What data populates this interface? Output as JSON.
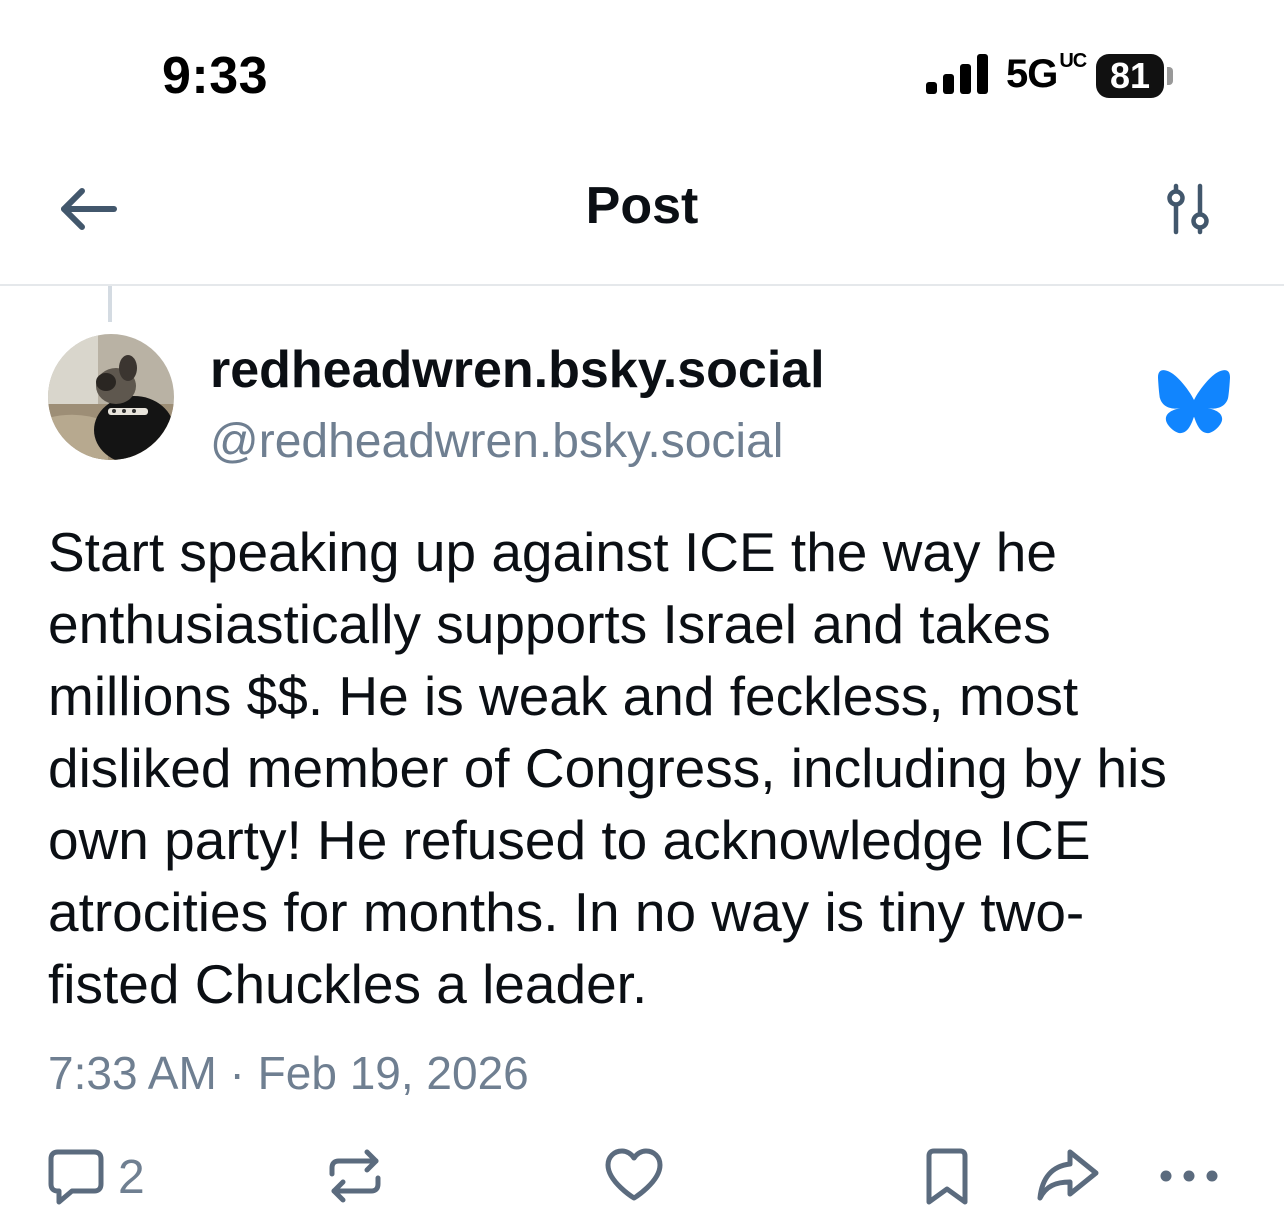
{
  "status_bar": {
    "time": "9:33",
    "network": "5G",
    "network_badge": "UC",
    "battery": "81"
  },
  "header": {
    "title": "Post",
    "back_icon": "arrow-left-icon",
    "settings_icon": "sliders-icon"
  },
  "post": {
    "author": {
      "display_name": "redheadwren.bsky.social",
      "handle": "@redheadwren.bsky.social"
    },
    "text": "Start speaking up against ICE the way he\nenthusiastically supports Israel and takes\nmillions $$. He is weak and feckless, most\ndisliked member of Congress, including by his\nown party! He refused to acknowledge ICE\natrocities for months. In no way is tiny two-\nfisted Chuckles a leader.",
    "timestamp": "7:33 AM · Feb 19, 2026",
    "reply_count": "2"
  },
  "colors": {
    "text": "#0b0f14",
    "muted": "#6f7f91",
    "icon": "#5b6b7e",
    "brand": "#1185fe",
    "divider": "#e5e8eb"
  },
  "icons": {
    "reply": "comment-icon",
    "repost": "repost-icon",
    "like": "heart-icon",
    "bookmark": "bookmark-icon",
    "share": "share-icon",
    "more": "more-icon"
  }
}
